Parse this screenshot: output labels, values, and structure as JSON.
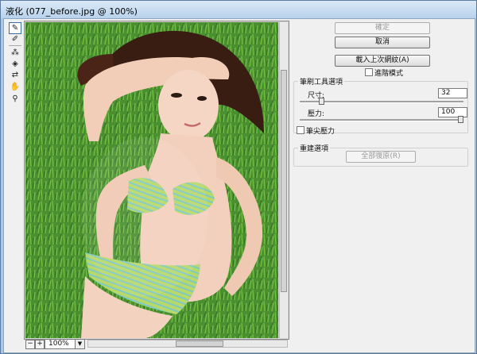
{
  "window": {
    "title": "液化 (077_before.jpg @ 100%)"
  },
  "buttons": {
    "ok": "確定",
    "cancel": "取消",
    "load_last_mesh": "載入上次網紋(A)",
    "restore_all": "全部復原(R)"
  },
  "advanced_mode": {
    "label": "進階模式",
    "checked": false
  },
  "brush_options": {
    "title": "筆刷工具選項",
    "size_label": "尺寸:",
    "size_value": "32",
    "size_level": 0.12,
    "pressure_label": "壓力:",
    "pressure_value": "100",
    "pressure_level": 1.0,
    "stylus_label": "筆尖壓力",
    "stylus_checked": false
  },
  "reconstruct_options": {
    "title": "重建選項"
  },
  "zoom": {
    "value": "100%"
  },
  "tools": [
    {
      "icon": "forward-warp-icon",
      "glyph": "✎"
    },
    {
      "icon": "reconstruct-icon",
      "glyph": "✐"
    },
    {
      "icon": "pucker-icon",
      "glyph": "⁂"
    },
    {
      "icon": "bloat-icon",
      "glyph": "◈"
    },
    {
      "icon": "push-left-icon",
      "glyph": "⇄"
    },
    {
      "icon": "hand-icon",
      "glyph": "✋"
    },
    {
      "icon": "zoom-icon",
      "glyph": "⚲"
    }
  ]
}
